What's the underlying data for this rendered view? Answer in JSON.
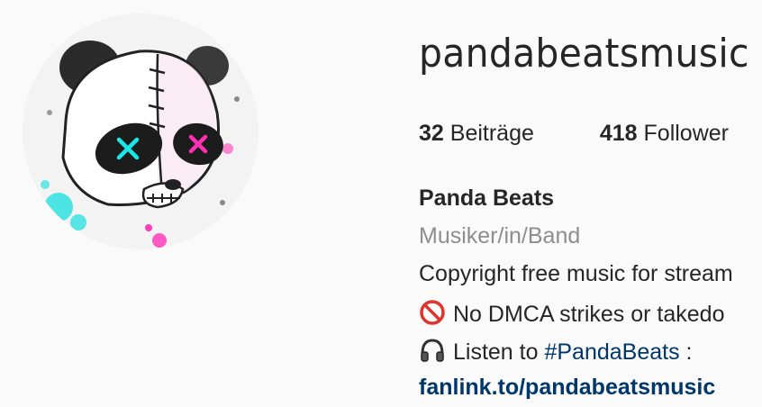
{
  "profile": {
    "username": "pandabeatsmusic",
    "avatar_icon": "panda-avatar-icon",
    "stats": {
      "posts_count": "32",
      "posts_label": "Beiträge",
      "followers_count": "418",
      "followers_label": "Follower"
    },
    "full_name": "Panda Beats",
    "category": "Musiker/in/Band",
    "bio": {
      "line1": "Copyright free music for stream",
      "line2_icon": "prohibited-icon",
      "line2_text": "No DMCA strikes or takedo",
      "line3_icon": "headphones-icon",
      "line3_prefix": "Listen to",
      "line3_hashtag": "#PandaBeats",
      "line3_suffix": " :"
    },
    "link": "fanlink.to/pandabeatsmusic"
  },
  "colors": {
    "text": "#262626",
    "secondary": "#8e8e8e",
    "link": "#00376b",
    "background": "#fafafa",
    "eye_cyan": "#19e6e6",
    "eye_magenta": "#ff2fb4"
  }
}
